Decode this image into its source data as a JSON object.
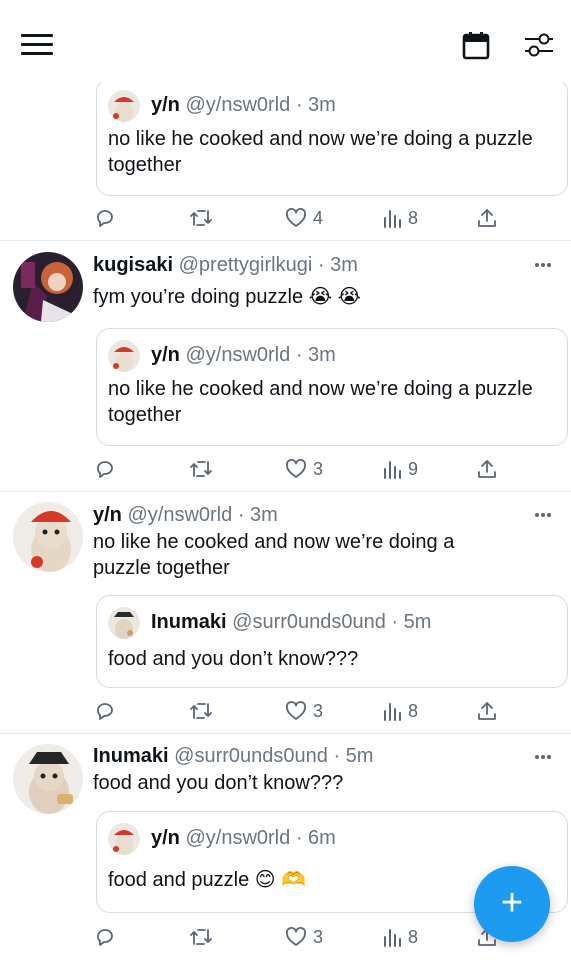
{
  "colors": {
    "accent": "#1d9bf0",
    "text": "#0f1419",
    "secondary_text": "#6b7680",
    "border": "#d8dde2"
  },
  "topbar": {
    "icons": [
      "menu-icon",
      "calendar-icon",
      "filter-settings-icon"
    ]
  },
  "tweets": [
    {
      "quote": {
        "name": "y/n",
        "handle": "@y/nsw0rld",
        "sep": "·",
        "time": "3m",
        "text": "no like he cooked and now we’re doing a puzzle together"
      },
      "actions": {
        "likes": "4",
        "views": "8"
      }
    },
    {
      "name": "kugisaki",
      "handle": "@prettygirlkugi",
      "sep": "·",
      "time": "3m",
      "text": "fym you’re doing puzzle 😭 😭",
      "quote": {
        "name": "y/n",
        "handle": "@y/nsw0rld",
        "sep": "·",
        "time": "3m",
        "text": "no like he cooked and now we’re doing a puzzle together"
      },
      "actions": {
        "likes": "3",
        "views": "9"
      }
    },
    {
      "name": "y/n",
      "handle": "@y/nsw0rld",
      "sep": "·",
      "time": "3m",
      "text": "no like he cooked and now we’re doing a puzzle together",
      "quote": {
        "name": "Inumaki",
        "handle": "@surr0unds0und",
        "sep": "·",
        "time": "5m",
        "text": "food and you don’t know???"
      },
      "actions": {
        "likes": "3",
        "views": "8"
      }
    },
    {
      "name": "Inumaki",
      "handle": "@surr0unds0und",
      "sep": "·",
      "time": "5m",
      "text": "food and you don’t know???",
      "quote": {
        "name": "y/n",
        "handle": "@y/nsw0rld",
        "sep": "·",
        "time": "6m",
        "text": "food and puzzle 😊 🫶"
      },
      "actions": {
        "likes": "3",
        "views": "8"
      }
    }
  ],
  "fab": {
    "label": "+"
  }
}
